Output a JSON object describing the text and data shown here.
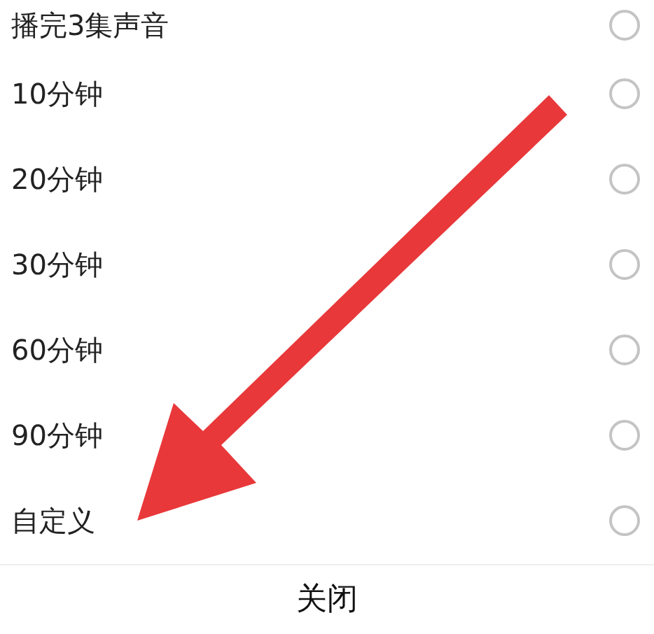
{
  "options": [
    {
      "label": "播完3集声音",
      "selected": false
    },
    {
      "label": "10分钟",
      "selected": false
    },
    {
      "label": "20分钟",
      "selected": false
    },
    {
      "label": "30分钟",
      "selected": false
    },
    {
      "label": "60分钟",
      "selected": false
    },
    {
      "label": "90分钟",
      "selected": false
    },
    {
      "label": "自定义",
      "selected": false
    }
  ],
  "annotation": {
    "kind": "arrow",
    "color": "#e8383a"
  },
  "footer": {
    "close": "关闭"
  }
}
